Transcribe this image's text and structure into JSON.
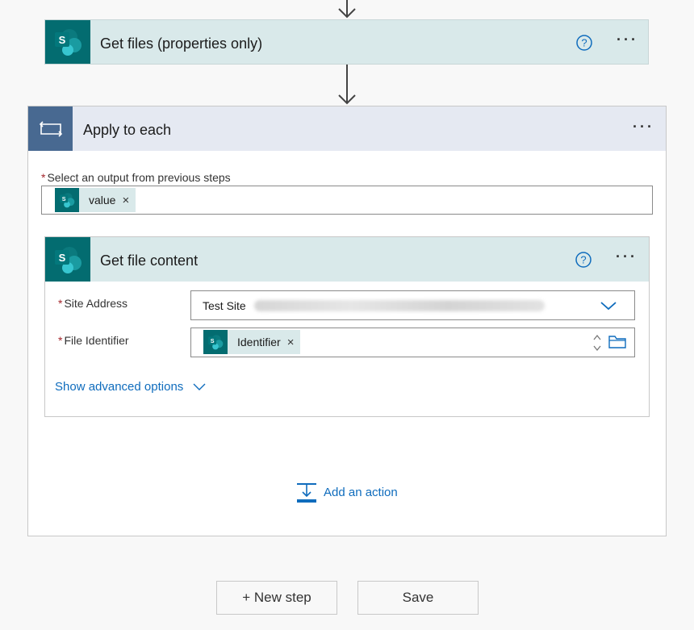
{
  "get_files": {
    "title": "Get files (properties only)"
  },
  "apply_each": {
    "title": "Apply to each",
    "output_label": "Select an output from previous steps",
    "output_token": "value"
  },
  "get_file_content": {
    "title": "Get file content",
    "site_label": "Site Address",
    "site_value": "Test Site",
    "file_label": "File Identifier",
    "file_token": "Identifier",
    "advanced_link": "Show advanced options"
  },
  "add_action": "Add an action",
  "footer": {
    "new_step": "+ New step",
    "save": "Save"
  },
  "token_remove_glyph": "×",
  "more_glyph": "···",
  "required_mark": "*",
  "sharepoint_letter": "S",
  "colors": {
    "sharepoint": "#036c70",
    "apply_each": "#486991",
    "link": "#0f6cbd",
    "required": "#a4262c"
  }
}
